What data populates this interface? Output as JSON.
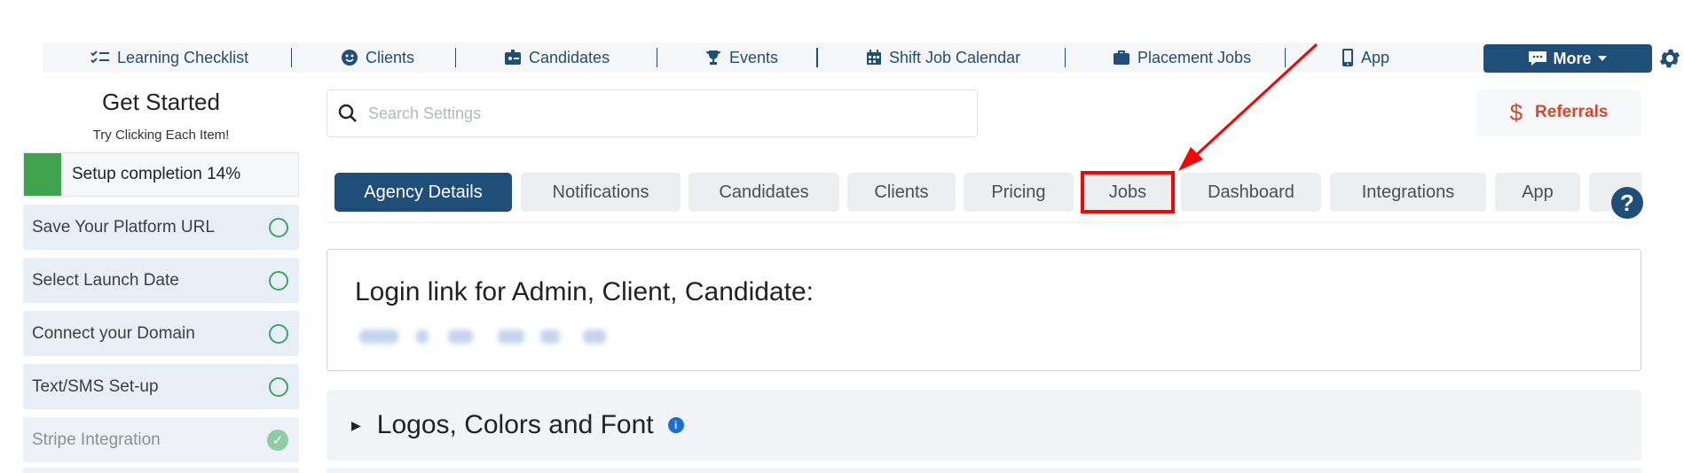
{
  "topnav": {
    "items": [
      {
        "label": "Learning Checklist",
        "icon": "checklist-icon"
      },
      {
        "label": "Clients",
        "icon": "smile-icon"
      },
      {
        "label": "Candidates",
        "icon": "id-card-icon"
      },
      {
        "label": "Events",
        "icon": "trophy-icon"
      },
      {
        "label": "Shift Job Calendar",
        "icon": "calendar-icon"
      },
      {
        "label": "Placement Jobs",
        "icon": "briefcase-icon"
      },
      {
        "label": "App",
        "icon": "phone-icon"
      }
    ],
    "more_label": "More",
    "settings_icon": "gear-icon"
  },
  "sidebar": {
    "title": "Get Started",
    "subtitle": "Try Clicking Each Item!",
    "progress_label": "Setup completion 14%",
    "progress_percent": 14,
    "items": [
      {
        "label": "Save Your Platform URL",
        "done": false
      },
      {
        "label": "Select Launch Date",
        "done": false
      },
      {
        "label": "Connect your Domain",
        "done": false
      },
      {
        "label": "Text/SMS Set-up",
        "done": false
      },
      {
        "label": "Stripe Integration",
        "done": true
      }
    ]
  },
  "search": {
    "placeholder": "Search Settings"
  },
  "referrals": {
    "symbol": "$",
    "label": "Referrals"
  },
  "tabs": [
    {
      "label": "Agency Details",
      "active": true
    },
    {
      "label": "Notifications"
    },
    {
      "label": "Candidates"
    },
    {
      "label": "Clients"
    },
    {
      "label": "Pricing"
    },
    {
      "label": "Jobs"
    },
    {
      "label": "Dashboard"
    },
    {
      "label": "Integrations"
    },
    {
      "label": "App"
    }
  ],
  "help_label": "?",
  "login_card": {
    "title": "Login link for Admin, Client, Candidate:"
  },
  "section": {
    "title": "Logos, Colors and Font",
    "info_label": "i"
  },
  "colors": {
    "primary": "#1f4e79",
    "referral": "#d9472b",
    "success": "#3fa34d",
    "annotation": "#ff0000"
  }
}
